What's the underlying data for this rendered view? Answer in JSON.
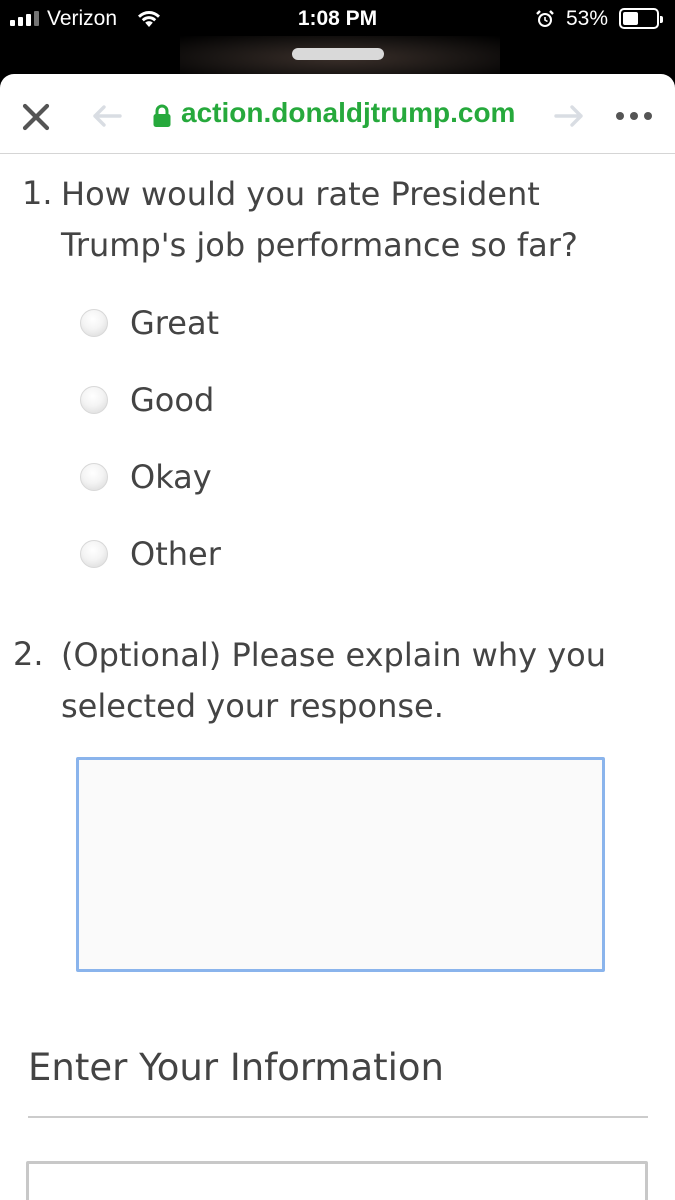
{
  "status_bar": {
    "carrier": "Verizon",
    "time": "1:08 PM",
    "battery_percent": "53%",
    "battery_level": 0.53,
    "icons": [
      "signal-icon",
      "wifi-icon",
      "alarm-icon",
      "battery-icon"
    ]
  },
  "browser": {
    "url": "action.donaldjtrump.com",
    "secure": true,
    "icons": [
      "close-icon",
      "back-arrow-icon",
      "lock-icon",
      "forward-arrow-icon",
      "more-icon"
    ],
    "url_color": "#26a93c"
  },
  "survey": {
    "question_1": {
      "number": "1.",
      "line_1": "How would you rate President",
      "line_2": "Trump's job performance so far?",
      "options": [
        "Great",
        "Good",
        "Okay",
        "Other"
      ]
    },
    "question_2": {
      "number": "2.",
      "line_1": "(Optional) Please explain why you",
      "line_2": "selected your response.",
      "response": ""
    }
  },
  "info_section": {
    "title": "Enter Your Information"
  },
  "colors": {
    "focus_border": "#8ab4ec",
    "text": "#444444"
  }
}
